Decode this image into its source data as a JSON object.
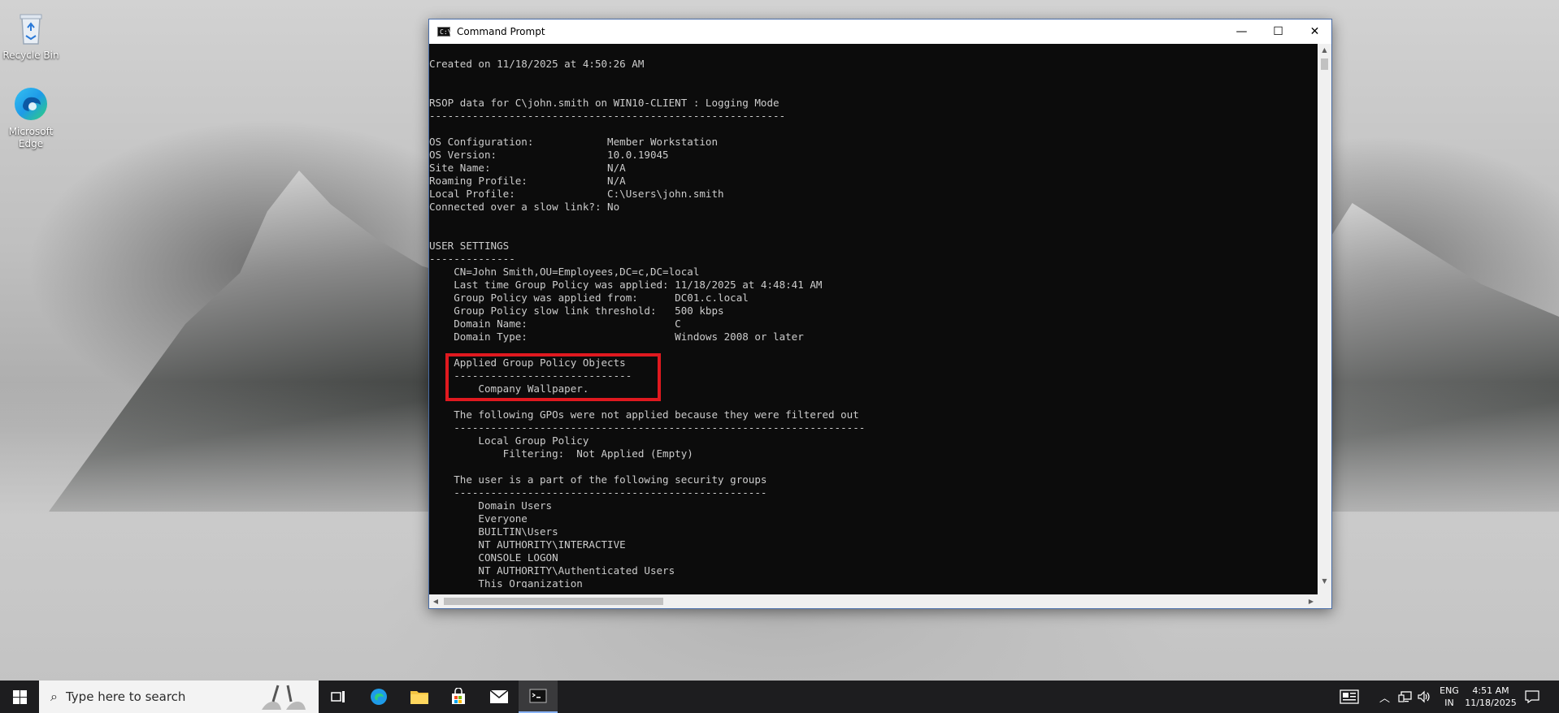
{
  "desktop": {
    "icons": [
      {
        "label": "Recycle Bin"
      },
      {
        "label": "Microsoft Edge"
      }
    ]
  },
  "window": {
    "title": "Command Prompt",
    "minimize": "—",
    "maximize": "☐",
    "close": "✕"
  },
  "console": {
    "lines": [
      "Created on ‎11/‎18/‎2025 at 4:50:26 AM",
      "",
      "",
      "RSOP data for C\\john.smith on WIN10-CLIENT : Logging Mode",
      "----------------------------------------------------------",
      "",
      "OS Configuration:            Member Workstation",
      "OS Version:                  10.0.19045",
      "Site Name:                   N/A",
      "Roaming Profile:             N/A",
      "Local Profile:               C:\\Users\\john.smith",
      "Connected over a slow link?: No",
      "",
      "",
      "USER SETTINGS",
      "--------------",
      "    CN=John Smith,OU=Employees,DC=c,DC=local",
      "    Last time Group Policy was applied: 11/18/2025 at 4:48:41 AM",
      "    Group Policy was applied from:      DC01.c.local",
      "    Group Policy slow link threshold:   500 kbps",
      "    Domain Name:                        C",
      "    Domain Type:                        Windows 2008 or later",
      "",
      "    Applied Group Policy Objects",
      "    -----------------------------",
      "        Company Wallpaper.",
      "",
      "    The following GPOs were not applied because they were filtered out",
      "    -------------------------------------------------------------------",
      "        Local Group Policy",
      "            Filtering:  Not Applied (Empty)",
      "",
      "    The user is a part of the following security groups",
      "    ---------------------------------------------------",
      "        Domain Users",
      "        Everyone",
      "        BUILTIN\\Users",
      "        NT AUTHORITY\\INTERACTIVE",
      "        CONSOLE LOGON",
      "        NT AUTHORITY\\Authenticated Users",
      "        This Organization"
    ]
  },
  "taskbar": {
    "search_placeholder": "Type here to search",
    "language_top": "ENG",
    "language_bottom": "IN",
    "time": "4:51 AM",
    "date": "11/18/2025"
  },
  "colors": {
    "highlight": "#e0191f",
    "console_bg": "#0c0c0c",
    "console_fg": "#cccccc",
    "taskbar_bg": "#1d1d1f"
  },
  "icons": {
    "recycle_bin": "recycle-bin-icon",
    "edge": "edge-icon",
    "start": "windows-start-icon",
    "search": "search-icon",
    "task_view": "task-view-icon",
    "file_explorer": "folder-icon",
    "store": "store-icon",
    "mail": "mail-icon",
    "cmd": "command-prompt-icon"
  }
}
